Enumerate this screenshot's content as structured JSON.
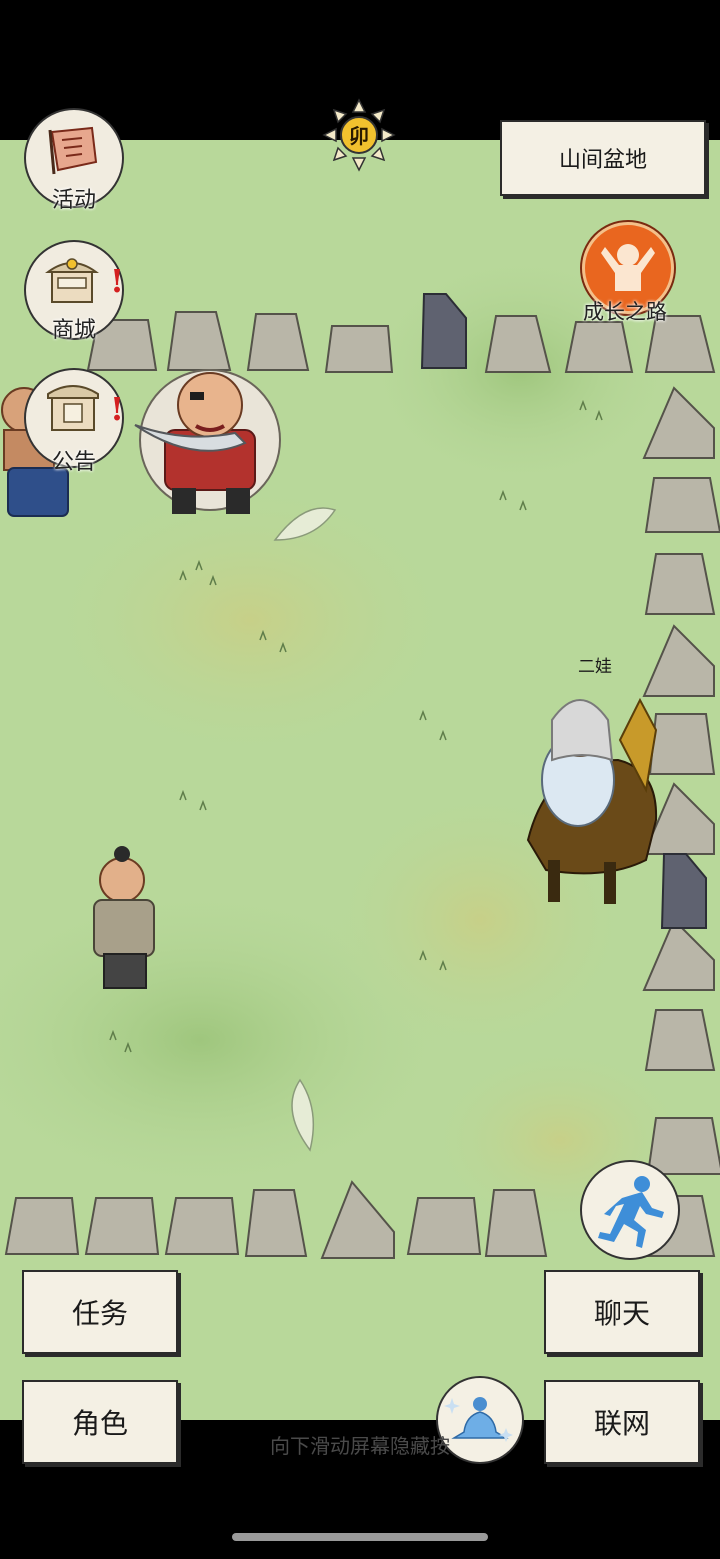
{
  "location": {
    "name": "山间盆地"
  },
  "time": {
    "glyph": "卯",
    "icon": "sun-icon"
  },
  "left_menu": [
    {
      "id": "events",
      "label": "活动",
      "icon": "banner-icon",
      "alert": false
    },
    {
      "id": "shop",
      "label": "商城",
      "icon": "shop-icon",
      "alert": true
    },
    {
      "id": "notice",
      "label": "公告",
      "icon": "notice-board-icon",
      "alert": true
    }
  ],
  "growth": {
    "label": "成长之路",
    "icon": "figure-icon"
  },
  "player": {
    "name": "二娃"
  },
  "buttons": {
    "quest": "任务",
    "character": "角色",
    "chat": "聊天",
    "online": "联网"
  },
  "alert_mark": "!",
  "hint": {
    "text": "向下滑动屏幕隐藏按"
  },
  "colors": {
    "grass": "#b8d89a",
    "panel": "#f4f0e4",
    "border": "#2b2b2b",
    "growth": "#e9661f",
    "alert": "#d42020"
  }
}
